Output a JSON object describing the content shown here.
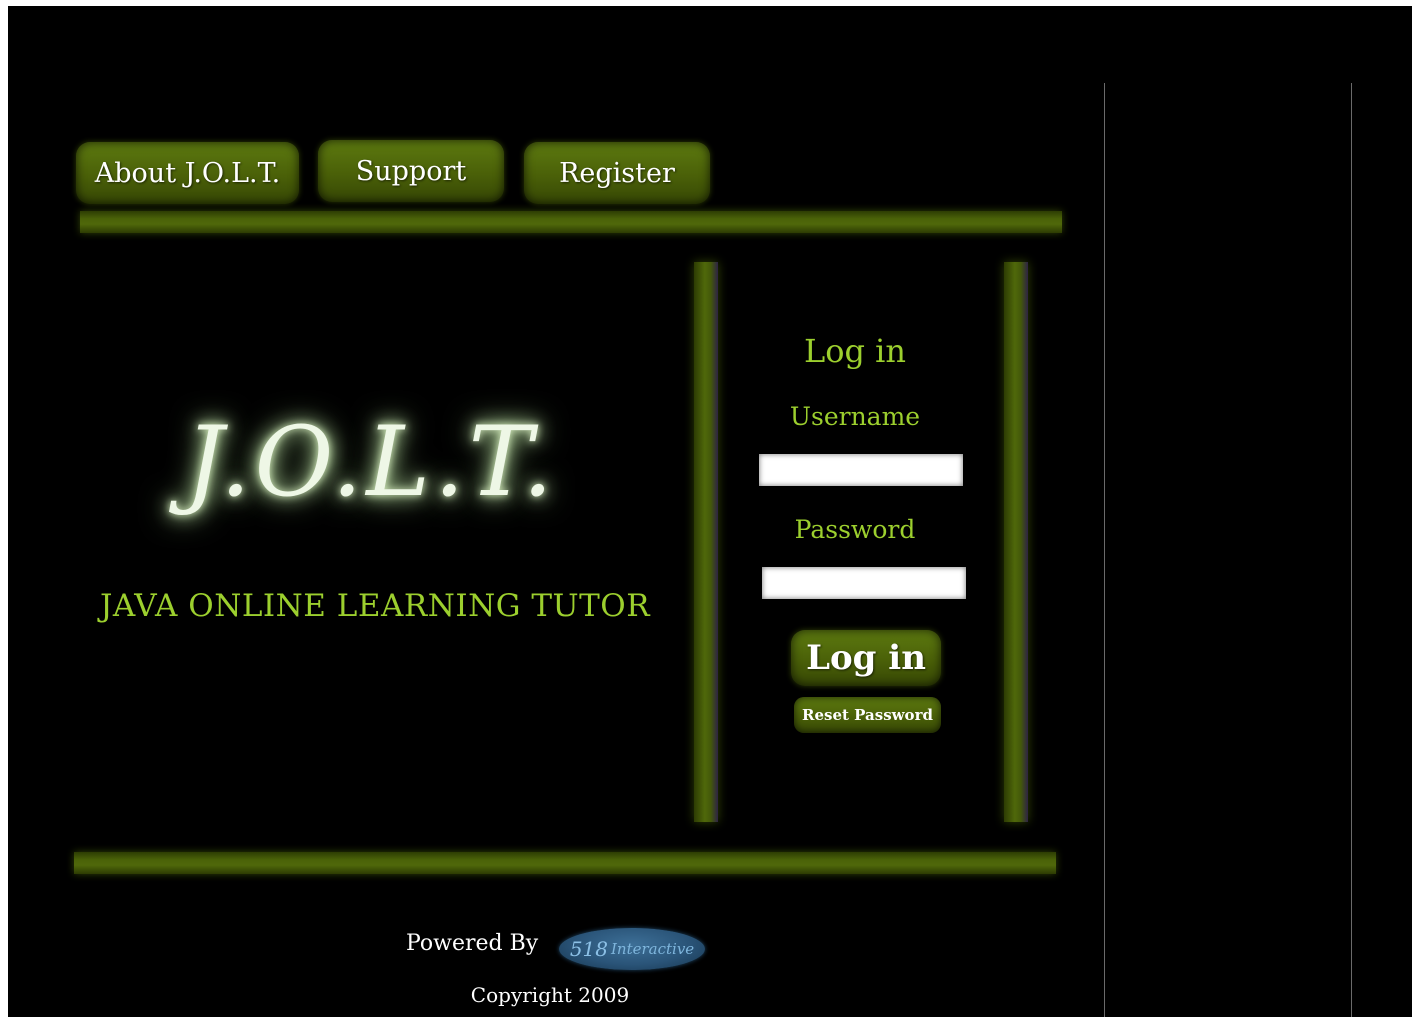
{
  "nav": {
    "about_label": "About J.O.L.T.",
    "support_label": "Support",
    "register_label": "Register"
  },
  "hero": {
    "logo_text": "J.O.L.T.",
    "tagline": "JAVA ONLINE LEARNING TUTOR"
  },
  "login": {
    "title": "Log in",
    "username_label": "Username",
    "username_value": "",
    "password_label": "Password",
    "password_value": "",
    "submit_label": "Log in",
    "reset_label": "Reset Password"
  },
  "footer": {
    "powered_by": "Powered By",
    "badge_number": "518",
    "badge_text": "Interactive",
    "copyright": "Copyright 2009"
  },
  "colors": {
    "background": "#000000",
    "accent_green": "#9ccf2e",
    "button_green": "#4a6008",
    "logo_glow": "#c8e8b0",
    "badge_blue": "#2a5478"
  }
}
